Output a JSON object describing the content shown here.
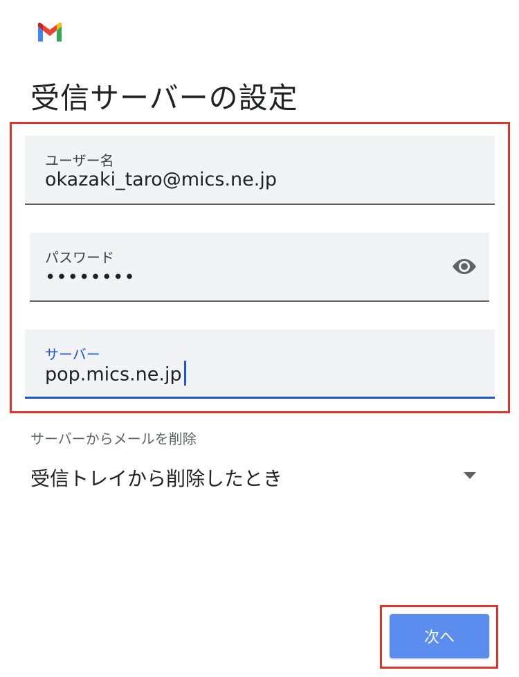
{
  "app": {
    "logo_icon": "gmail-logo-icon"
  },
  "page": {
    "title": "受信サーバーの設定"
  },
  "fields": {
    "username": {
      "label": "ユーザー名",
      "value": "okazaki_taro@mics.ne.jp"
    },
    "password": {
      "label": "パスワード",
      "value": "••••••••",
      "toggle_icon": "eye-icon"
    },
    "server": {
      "label": "サーバー",
      "value": "pop.mics.ne.jp"
    }
  },
  "delete_from_server": {
    "label": "サーバーからメールを削除",
    "selected": "受信トレイから削除したとき",
    "icon": "chevron-down-icon"
  },
  "actions": {
    "next_label": "次へ"
  },
  "colors": {
    "accent": "#1a56d6",
    "button": "#5b8def",
    "highlight": "#e0352b",
    "field_bg": "#f1f3f4"
  }
}
